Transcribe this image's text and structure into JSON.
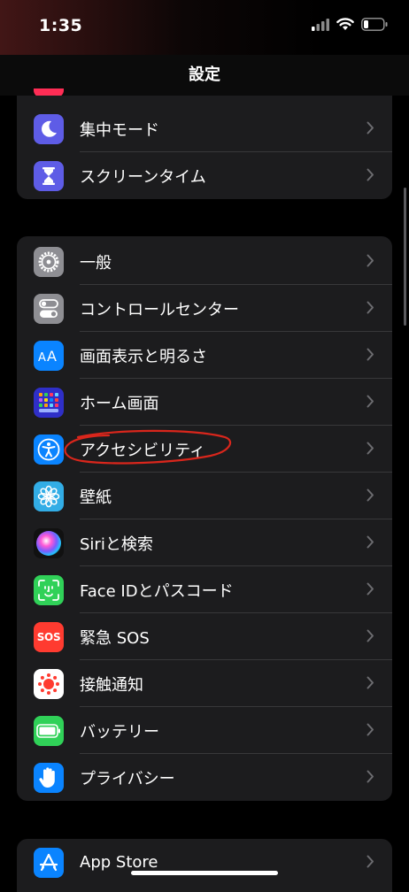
{
  "status": {
    "time": "1:35"
  },
  "nav": {
    "title": "設定"
  },
  "group1": [
    {
      "label": "集中モード",
      "icon": "moon-icon",
      "color": "#5e5ce6"
    },
    {
      "label": "スクリーンタイム",
      "icon": "hourglass-icon",
      "color": "#5e5ce6"
    }
  ],
  "group2": [
    {
      "label": "一般",
      "icon": "gear-icon",
      "color": "#8e8e93"
    },
    {
      "label": "コントロールセンター",
      "icon": "toggles-icon",
      "color": "#8e8e93"
    },
    {
      "label": "画面表示と明るさ",
      "icon": "text-size-icon",
      "color": "#0a84ff"
    },
    {
      "label": "ホーム画面",
      "icon": "home-grid-icon",
      "color": "#3a3ad9"
    },
    {
      "label": "アクセシビリティ",
      "icon": "accessibility-icon",
      "color": "#0a84ff"
    },
    {
      "label": "壁紙",
      "icon": "flower-icon",
      "color": "#32ade6"
    },
    {
      "label": "Siriと検索",
      "icon": "siri-icon",
      "color": "#111111"
    },
    {
      "label": "Face IDとパスコード",
      "icon": "faceid-icon",
      "color": "#30d158"
    },
    {
      "label": "緊急 SOS",
      "icon": "sos-icon",
      "color": "#ff3b30",
      "icon_text": "SOS"
    },
    {
      "label": "接触通知",
      "icon": "exposure-icon",
      "color": "#ffffff"
    },
    {
      "label": "バッテリー",
      "icon": "battery-icon",
      "color": "#30d158"
    },
    {
      "label": "プライバシー",
      "icon": "hand-icon",
      "color": "#0a84ff"
    }
  ],
  "group3": [
    {
      "label": "App Store",
      "icon": "appstore-icon",
      "color": "#0a84ff"
    }
  ]
}
